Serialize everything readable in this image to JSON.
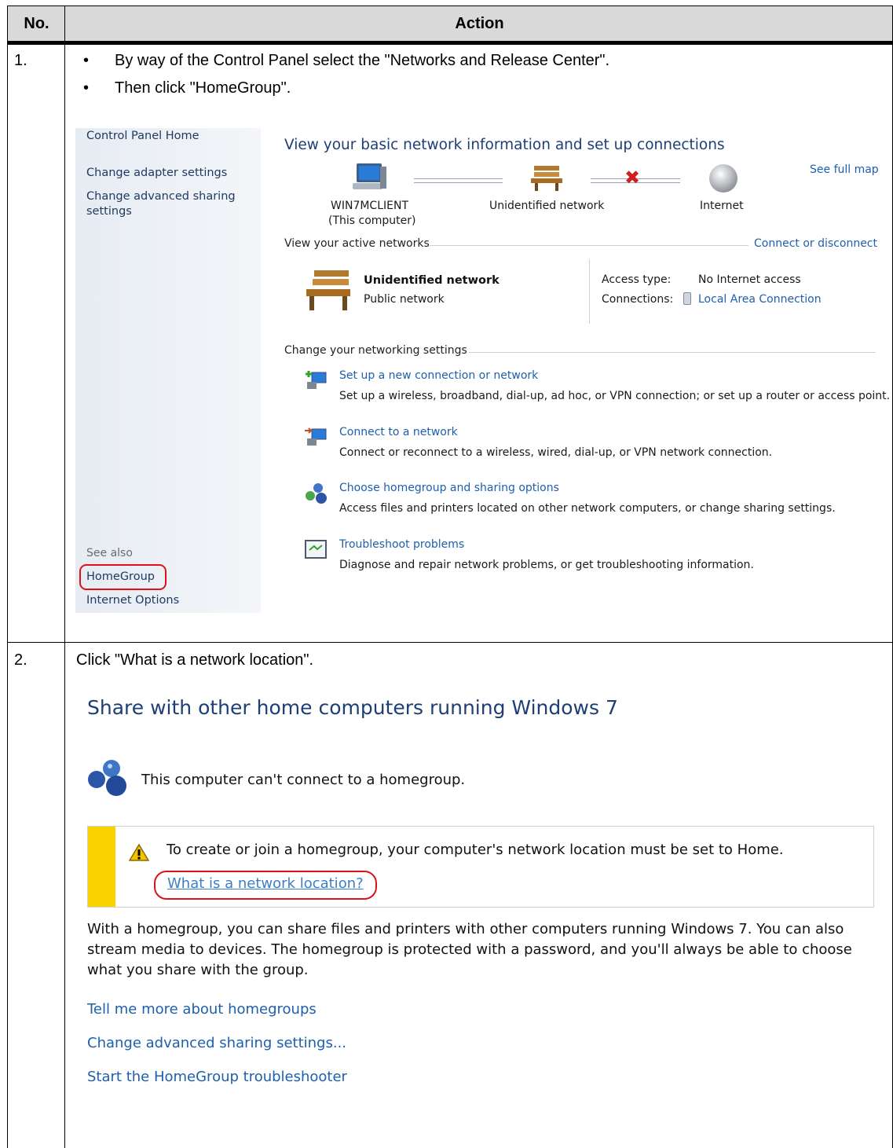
{
  "table": {
    "col_no": "No.",
    "col_action": "Action"
  },
  "step1": {
    "no": "1.",
    "bullet1": "By way of the Control Panel select the \"Networks and Release Center\".",
    "bullet2": "Then click \"HomeGroup\".",
    "sidebar": {
      "control_panel_home": "Control Panel Home",
      "change_adapter": "Change adapter settings",
      "change_advanced_1": "Change advanced sharing",
      "change_advanced_2": "settings",
      "see_also": "See also",
      "homegroup": "HomeGroup",
      "internet_options": "Internet Options"
    },
    "main": {
      "title": "View your basic network information and set up connections",
      "see_full_map": "See full map",
      "computer_name": "WIN7MCLIENT",
      "computer_sub": "(This computer)",
      "network_name": "Unidentified network",
      "internet": "Internet",
      "active_networks": "View your active networks",
      "connect_disconnect": "Connect or disconnect",
      "active_name": "Unidentified network",
      "active_type": "Public network",
      "access_type_label": "Access type:",
      "access_type_value": "No Internet access",
      "connections_label": "Connections:",
      "connections_value": "Local Area Connection",
      "change_settings": "Change your networking settings",
      "tasks": [
        {
          "title": "Set up a new connection or network",
          "desc": "Set up a wireless, broadband, dial-up, ad hoc, or VPN connection; or set up a router or access point."
        },
        {
          "title": "Connect to a network",
          "desc": "Connect or reconnect to a wireless, wired, dial-up, or VPN network connection."
        },
        {
          "title": "Choose homegroup and sharing options",
          "desc": "Access files and printers located on other network computers, or change sharing settings."
        },
        {
          "title": "Troubleshoot problems",
          "desc": "Diagnose and repair network problems, or get troubleshooting information."
        }
      ]
    }
  },
  "step2": {
    "no": "2.",
    "instruction": "Click \"What is a network location\".",
    "title": "Share with other home computers running Windows 7",
    "status": "This computer can't connect to a homegroup.",
    "warning": "To create or join a homegroup, your computer's network location must be set to Home.",
    "what_link": "What is a network location?",
    "para1": "With a homegroup, you can share files and printers with other computers running Windows 7. You can also",
    "para2": "stream media to devices. The homegroup is protected with a password, and you'll always be able to choose",
    "para3": "what you share with the group.",
    "links": [
      "Tell me more about homegroups",
      "Change advanced sharing settings...",
      "Start the HomeGroup troubleshooter"
    ]
  },
  "colors": {
    "link": "#1e5fad",
    "highlight": "#e0101a",
    "header_bg": "#d9d9d9",
    "warning_stripe": "#f9d200"
  }
}
